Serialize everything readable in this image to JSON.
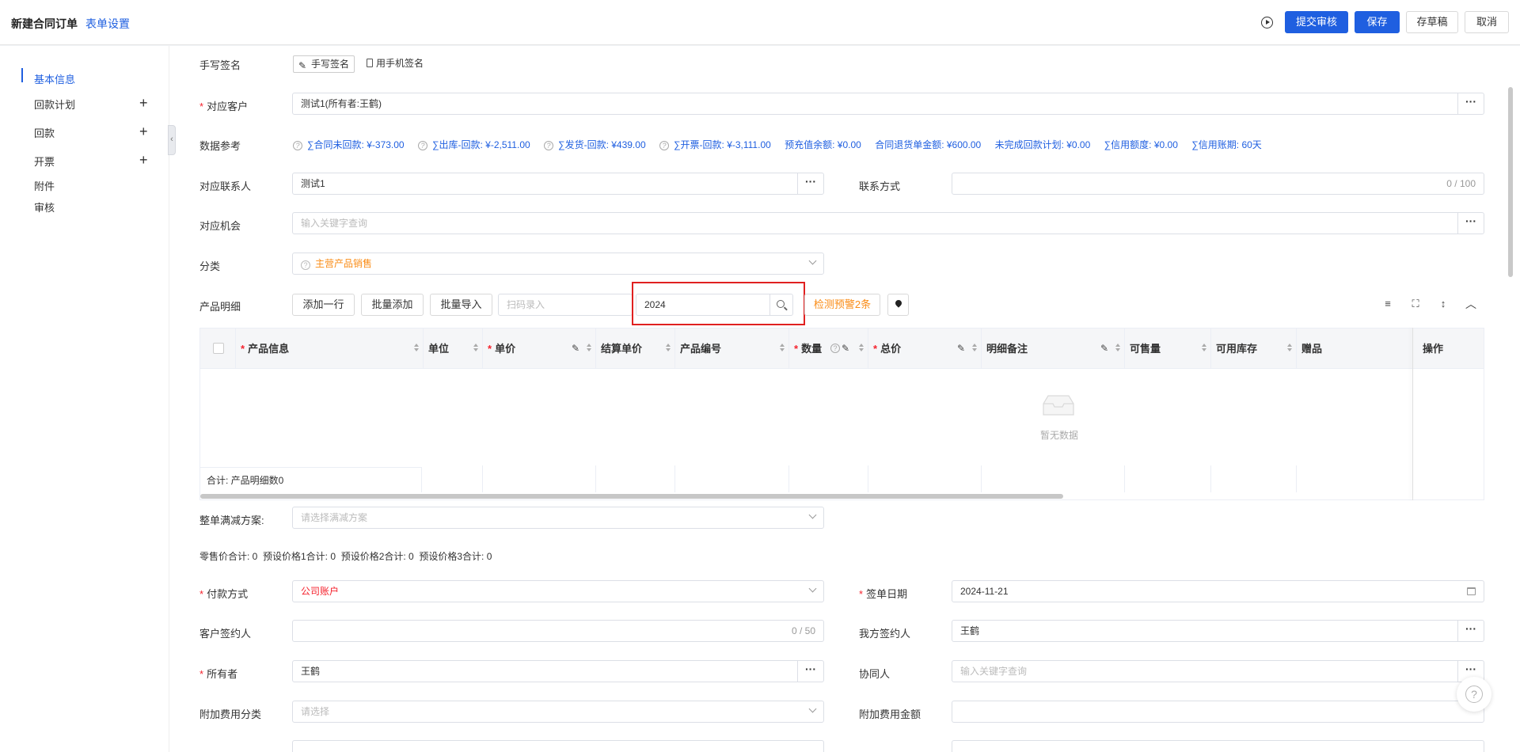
{
  "header": {
    "title": "新建合同订单",
    "form_setting": "表单设置",
    "buttons": {
      "submit": "提交审核",
      "save": "保存",
      "draft": "存草稿",
      "cancel": "取消"
    }
  },
  "sidebar": {
    "items": [
      {
        "label": "基本信息"
      },
      {
        "label": "回款计划"
      },
      {
        "label": "回款"
      },
      {
        "label": "开票"
      },
      {
        "label": "附件"
      },
      {
        "label": "审核"
      }
    ],
    "plus": "+"
  },
  "form": {
    "signature": {
      "label": "手写签名",
      "handwrite_btn": "手写签名",
      "phone_btn": "用手机签名"
    },
    "customer": {
      "label": "对应客户",
      "value": "测试1(所有者:王鹤)"
    },
    "data_ref": {
      "label": "数据参考",
      "items": [
        "∑合同未回款: ¥-373.00",
        "∑出库-回款: ¥-2,511.00",
        "∑发货-回款: ¥439.00",
        "∑开票-回款: ¥-3,111.00",
        "预充值余额: ¥0.00",
        "合同退货单金额: ¥600.00",
        "未完成回款计划: ¥0.00",
        "∑信用额度: ¥0.00",
        "∑信用账期: 60天"
      ]
    },
    "contact": {
      "label": "对应联系人",
      "value": "测试1"
    },
    "contact_method": {
      "label": "联系方式",
      "counter": "0 / 100"
    },
    "opportunity": {
      "label": "对应机会",
      "placeholder": "输入关键字查询"
    },
    "category": {
      "label": "分类",
      "value": "主营产品销售"
    },
    "products": {
      "label": "产品明细",
      "add_row": "添加一行",
      "batch_add": "批量添加",
      "batch_import": "批量导入",
      "scan_placeholder": "扫码录入",
      "search_value": "2024",
      "warn": "检测预警2条",
      "columns": [
        "产品信息",
        "单位",
        "单价",
        "结算单价",
        "产品编号",
        "数量",
        "总价",
        "明细备注",
        "可售量",
        "可用库存",
        "赠品",
        "操作"
      ],
      "empty": "暂无数据",
      "summary": "合计: 产品明细数0"
    },
    "discount": {
      "label": "整单满减方案:",
      "placeholder": "请选择满减方案"
    },
    "price_summary": "零售价合计: 0  预设价格1合计: 0  预设价格2合计: 0  预设价格3合计: 0",
    "payment": {
      "label": "付款方式",
      "value": "公司账户"
    },
    "sign_date": {
      "label": "签单日期",
      "value": "2024-11-21"
    },
    "customer_signer": {
      "label": "客户签约人",
      "counter": "0 / 50"
    },
    "our_signer": {
      "label": "我方签约人",
      "value": "王鹤"
    },
    "owner": {
      "label": "所有者",
      "value": "王鹤"
    },
    "collaborator": {
      "label": "协同人",
      "placeholder": "输入关键字查询"
    },
    "extra_fee_type": {
      "label": "附加费用分类",
      "placeholder": "请选择"
    },
    "extra_fee_amount": {
      "label": "附加费用金额"
    }
  },
  "colors": {
    "primary": "#1f5fe0",
    "required": "#f5222d",
    "warning": "#fa8c16",
    "highlight": "#e02020"
  }
}
